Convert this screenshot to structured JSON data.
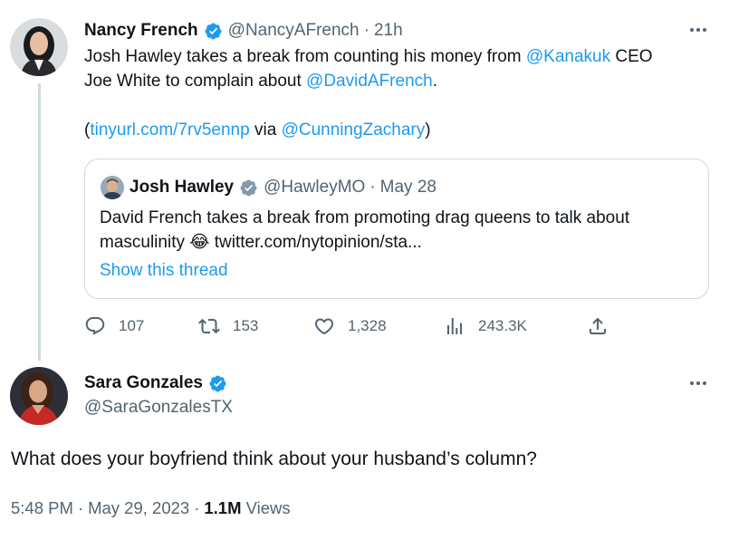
{
  "tweet1": {
    "display_name": "Nancy French",
    "handle": "@NancyAFrench",
    "separator": "·",
    "time": "21h",
    "text": {
      "l1_a": "Josh Hawley takes a break from counting his money from ",
      "l1_mention": "@Kanakuk",
      "l1_b": " CEO",
      "l2_a": "Joe White to complain about ",
      "l2_mention": "@DavidAFrench",
      "l2_b": ".",
      "l3_open": "(",
      "l3_link": "tinyurl.com/7rv5ennp",
      "l3_via": " via ",
      "l3_mention": "@CunningZachary",
      "l3_close": ")"
    },
    "quoted": {
      "display_name": "Josh Hawley",
      "handle": "@HawleyMO",
      "separator": "·",
      "date": "May 28",
      "line1": "David French takes a break from promoting drag queens to talk about",
      "line2_a": "masculinity ",
      "emoji": "😂",
      "line2_b": " twitter.com/nytopinion/sta...",
      "show_thread": "Show this thread"
    },
    "actions": {
      "replies": "107",
      "retweets": "153",
      "likes": "1,328",
      "views": "243.3K"
    }
  },
  "tweet2": {
    "display_name": "Sara Gonzales",
    "handle": "@SaraGonzalesTX",
    "text": "What does your boyfriend think about your husband’s column?",
    "time": "5:48 PM",
    "separator": "·",
    "date": "May 29, 2023",
    "views_count": "1.1M",
    "views_label": " Views"
  },
  "colors": {
    "accent": "#1d9bf0",
    "muted": "#536471",
    "border": "#cfd9de",
    "verified": "#1d9bf0",
    "verified_gov": "#829aab"
  },
  "icons": [
    "verified-badge-icon",
    "more-icon",
    "reply-icon",
    "retweet-icon",
    "like-icon",
    "views-icon",
    "share-icon"
  ]
}
